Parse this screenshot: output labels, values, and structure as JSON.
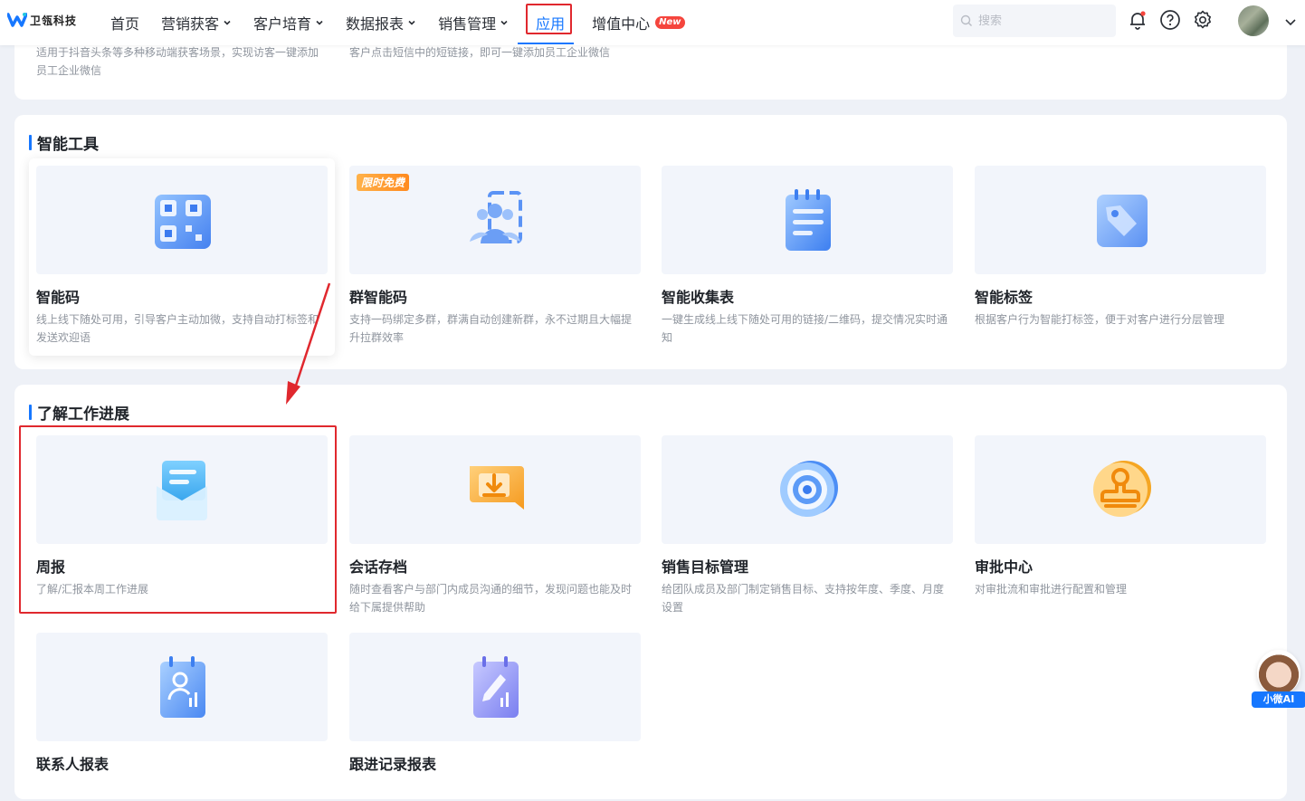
{
  "brand": {
    "name": "卫瓴科技"
  },
  "nav": {
    "items": [
      {
        "label": "首页",
        "has_dropdown": false
      },
      {
        "label": "营销获客",
        "has_dropdown": true
      },
      {
        "label": "客户培育",
        "has_dropdown": true
      },
      {
        "label": "数据报表",
        "has_dropdown": true
      },
      {
        "label": "销售管理",
        "has_dropdown": true
      },
      {
        "label": "应用",
        "has_dropdown": false,
        "active": true
      },
      {
        "label": "增值中心",
        "has_dropdown": false,
        "badge": "New"
      }
    ]
  },
  "search": {
    "placeholder": "搜索"
  },
  "prev_section": {
    "cards": [
      {
        "desc": "适用于抖音头条等多种移动端获客场景，实现访客一键添加员工企业微信"
      },
      {
        "desc": "客户点击短信中的短链接，即可一键添加员工企业微信"
      }
    ]
  },
  "section_tools": {
    "title": "智能工具",
    "cards": [
      {
        "name": "智能码",
        "desc": "线上线下随处可用，引导客户主动加微，支持自动打标签和发送欢迎语",
        "icon": "qr-code-icon"
      },
      {
        "name": "群智能码",
        "desc": "支持一码绑定多群，群满自动创建新群，永不过期且大幅提升拉群效率",
        "icon": "group-qr-icon",
        "tag": "限时免费"
      },
      {
        "name": "智能收集表",
        "desc": "一键生成线上线下随处可用的链接/二维码，提交情况实时通知",
        "icon": "form-icon"
      },
      {
        "name": "智能标签",
        "desc": "根据客户行为智能打标签，便于对客户进行分层管理",
        "icon": "tag-icon"
      }
    ]
  },
  "section_progress": {
    "title": "了解工作进展",
    "cards": [
      {
        "name": "周报",
        "desc": "了解/汇报本周工作进展",
        "icon": "report-envelope-icon"
      },
      {
        "name": "会话存档",
        "desc": "随时查看客户与部门内成员沟通的细节，发现问题也能及时给下属提供帮助",
        "icon": "chat-archive-icon"
      },
      {
        "name": "销售目标管理",
        "desc": "给团队成员及部门制定销售目标、支持按年度、季度、月度设置",
        "icon": "target-icon"
      },
      {
        "name": "审批中心",
        "desc": "对审批流和审批进行配置和管理",
        "icon": "approval-stamp-icon"
      },
      {
        "name": "联系人报表",
        "desc": "",
        "icon": "contact-report-icon"
      },
      {
        "name": "跟进记录报表",
        "desc": "",
        "icon": "followup-report-icon"
      }
    ]
  },
  "ai_assistant": {
    "label": "小微AI"
  },
  "colors": {
    "accent": "#1677ff",
    "highlight": "#e0282e",
    "badge": "#f5453d"
  }
}
